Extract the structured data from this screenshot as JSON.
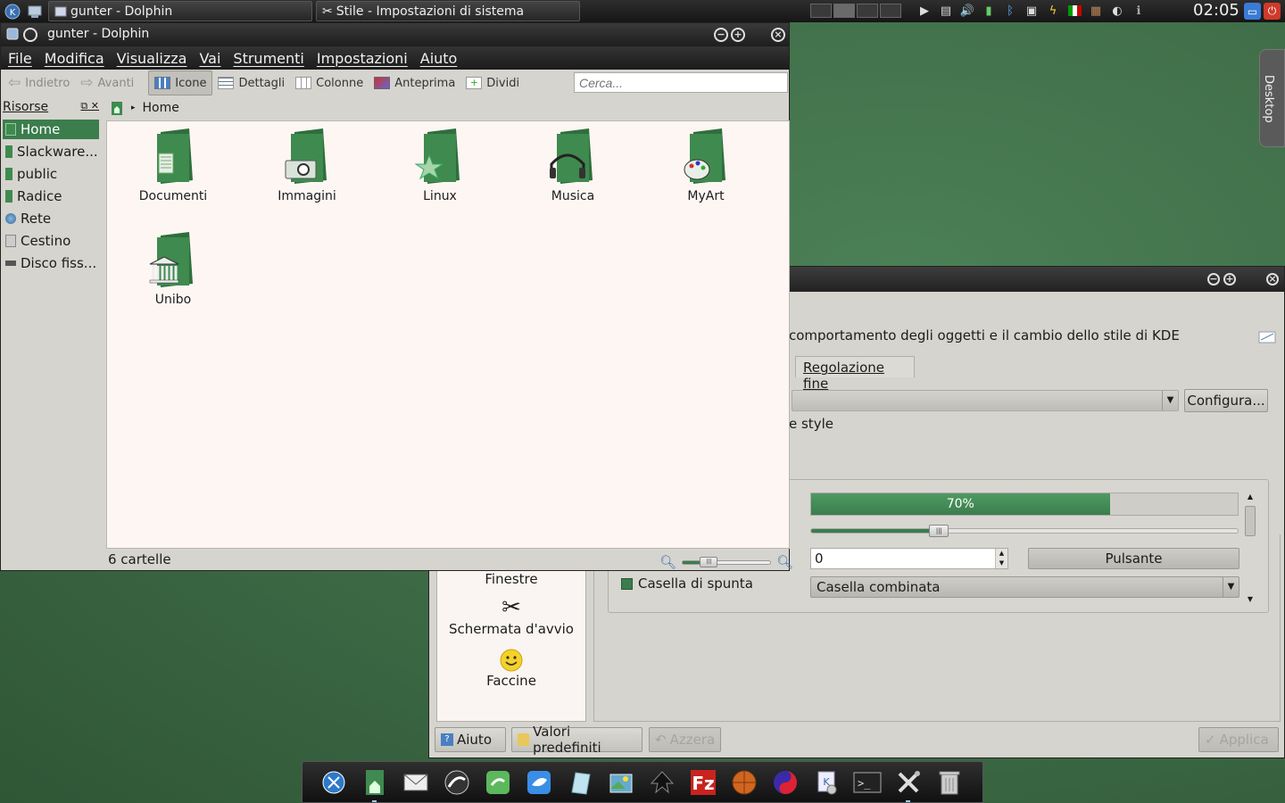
{
  "top_panel": {
    "tasks": [
      {
        "label": "gunter - Dolphin",
        "icon": "folder-icon"
      },
      {
        "label": "Stile - Impostazioni di sistema",
        "icon": "tools-icon"
      }
    ],
    "pager_desktops": 4,
    "active_desktop": 2,
    "clock": "02:05",
    "tray_icons": [
      "media-play-icon",
      "clipboard-icon",
      "volume-icon",
      "battery-icon",
      "bluetooth-icon",
      "network-icon",
      "power-icon",
      "language-flag-icon",
      "package-icon",
      "update-icon",
      "info-icon"
    ],
    "colors": {
      "lock": "#3a7bd5",
      "shutdown": "#d03a2a"
    }
  },
  "desktop_tab": {
    "label": "Desktop"
  },
  "dolphin": {
    "title": "gunter - Dolphin",
    "menu": [
      "File",
      "Modifica",
      "Visualizza",
      "Vai",
      "Strumenti",
      "Impostazioni",
      "Aiuto"
    ],
    "toolbar": {
      "back": "Indietro",
      "forward": "Avanti",
      "icons": "Icone",
      "details": "Dettagli",
      "columns": "Colonne",
      "preview": "Anteprima",
      "split": "Dividi",
      "search_placeholder": "Cerca..."
    },
    "places": {
      "header": "Risorse",
      "items": [
        {
          "label": "Home",
          "icon": "home-icon",
          "selected": true
        },
        {
          "label": "Slackware...",
          "icon": "folder-icon"
        },
        {
          "label": "public",
          "icon": "folder-icon"
        },
        {
          "label": "Radice",
          "icon": "folder-icon"
        },
        {
          "label": "Rete",
          "icon": "network-globe-icon"
        },
        {
          "label": "Cestino",
          "icon": "trash-icon"
        },
        {
          "label": "Disco fiss...",
          "icon": "hard-disk-icon"
        }
      ]
    },
    "breadcrumb": {
      "current": "Home"
    },
    "files": [
      {
        "label": "Documenti",
        "emblem": "document"
      },
      {
        "label": "Immagini",
        "emblem": "camera"
      },
      {
        "label": "Linux",
        "emblem": "star"
      },
      {
        "label": "Musica",
        "emblem": "headphones"
      },
      {
        "label": "MyArt",
        "emblem": "palette"
      },
      {
        "label": "Unibo",
        "emblem": "building"
      }
    ],
    "status": "6 cartelle",
    "zoom_level": 0.3,
    "colors": {
      "accent": "#3b7d4d",
      "folder": "#3f8a4f"
    }
  },
  "settings": {
    "description": "comportamento degli oggetti e il cambio dello stile di KDE",
    "tab_label": "Regolazione fine",
    "configure_button": "Configura...",
    "style_label": "e style",
    "preview": {
      "progress_label": "70%",
      "progress_value": 0.7,
      "slider_value": 0.3,
      "spin_value": "0",
      "button_label": "Pulsante",
      "checkbox_label": "Casella di spunta",
      "checkbox_checked": true,
      "combo_label": "Casella combinata"
    },
    "sidebar_items": [
      {
        "label": "Finestre",
        "icon": null
      },
      {
        "label": "Schermata d'avvio",
        "icon": "tools-icon"
      },
      {
        "label": "Faccine",
        "icon": "smiley-icon"
      }
    ],
    "buttons": {
      "help": "Aiuto",
      "defaults": "Valori predefiniti",
      "reset": "Azzera",
      "apply": "Applica"
    }
  },
  "dock": {
    "apps": [
      "kde-launcher-icon",
      "home-folder-icon",
      "mail-icon",
      "web-browser-icon",
      "chat-icon",
      "messenger-icon",
      "notes-icon",
      "image-viewer-icon",
      "inkscape-icon",
      "filezilla-icon",
      "basketball-game-icon",
      "yinyang-icon",
      "office-icon",
      "terminal-icon",
      "settings-tools-icon",
      "trash-icon"
    ]
  }
}
